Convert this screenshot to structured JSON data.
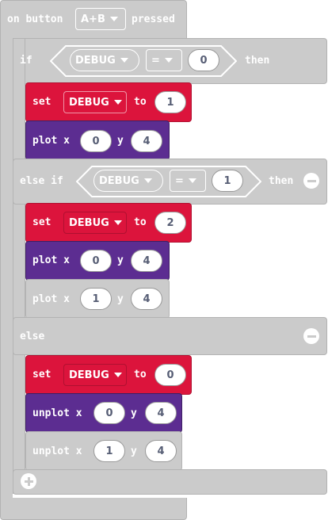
{
  "event": {
    "prefix": "on button",
    "button": "A+B",
    "suffix": "pressed"
  },
  "if_block": {
    "if_label": "if",
    "then_label": "then",
    "cond1": {
      "var": "DEBUG",
      "op": "=",
      "value": "0"
    },
    "set1": {
      "set_label": "set",
      "var": "DEBUG",
      "to_label": "to",
      "value": "1"
    },
    "plot1": {
      "label": "plot x",
      "x": "0",
      "y_label": "y",
      "y": "4"
    },
    "elseif_label": "else if",
    "cond2": {
      "var": "DEBUG",
      "op": "=",
      "value": "1"
    },
    "set2": {
      "set_label": "set",
      "var": "DEBUG",
      "to_label": "to",
      "value": "2"
    },
    "plot2": {
      "label": "plot x",
      "x": "0",
      "y_label": "y",
      "y": "4"
    },
    "plot3": {
      "label": "plot x",
      "x": "1",
      "y_label": "y",
      "y": "4"
    },
    "else_label": "else",
    "set3": {
      "set_label": "set",
      "var": "DEBUG",
      "to_label": "to",
      "value": "0"
    },
    "unplot1": {
      "label": "unplot x",
      "x": "0",
      "y_label": "y",
      "y": "4"
    },
    "unplot2": {
      "label": "unplot x",
      "x": "1",
      "y_label": "y",
      "y": "4"
    }
  },
  "colors": {
    "event": "#cbcbcb",
    "variables": "#dc143c",
    "led": "#5c2d91",
    "disabled": "#cbcbcb"
  }
}
